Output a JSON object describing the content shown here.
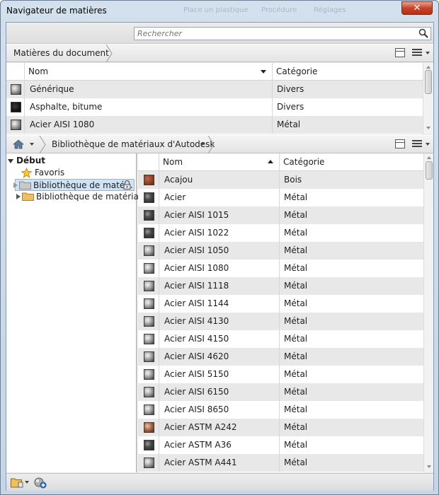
{
  "window": {
    "title": "Navigateur de matières",
    "close_glyph": "✕",
    "ghost_tabs": [
      "Place un plastique",
      "Procédure",
      "Réglages"
    ]
  },
  "search": {
    "placeholder": "Rechercher",
    "value": ""
  },
  "document_materials": {
    "breadcrumb": "Matières du document",
    "columns": [
      "Nom",
      "Catégorie"
    ],
    "rows": [
      {
        "name": "Générique",
        "category": "Divers",
        "swatch": "gray-sphere"
      },
      {
        "name": "Asphalte, bitume",
        "category": "Divers",
        "swatch": "black"
      },
      {
        "name": "Acier AISI 1080",
        "category": "Métal",
        "swatch": "gray-sphere"
      }
    ]
  },
  "library": {
    "breadcrumb": "Bibliothèque de matériaux d'Autodesk",
    "columns": [
      "Nom",
      "Catégorie"
    ],
    "rows": [
      {
        "name": "Acajou",
        "category": "Bois",
        "swatch": "wood"
      },
      {
        "name": "Acier",
        "category": "Métal",
        "swatch": "dark-sphere"
      },
      {
        "name": "Acier AISI 1015",
        "category": "Métal",
        "swatch": "dark-sphere"
      },
      {
        "name": "Acier AISI 1022",
        "category": "Métal",
        "swatch": "dark-sphere"
      },
      {
        "name": "Acier AISI 1050",
        "category": "Métal",
        "swatch": "gray-sphere"
      },
      {
        "name": "Acier AISI 1080",
        "category": "Métal",
        "swatch": "gray-sphere"
      },
      {
        "name": "Acier AISI 1118",
        "category": "Métal",
        "swatch": "gray-sphere"
      },
      {
        "name": "Acier AISI 1144",
        "category": "Métal",
        "swatch": "gray-sphere"
      },
      {
        "name": "Acier AISI 4130",
        "category": "Métal",
        "swatch": "gray-sphere"
      },
      {
        "name": "Acier AISI 4150",
        "category": "Métal",
        "swatch": "gray-sphere"
      },
      {
        "name": "Acier AISI 4620",
        "category": "Métal",
        "swatch": "gray-sphere"
      },
      {
        "name": "Acier AISI 5150",
        "category": "Métal",
        "swatch": "gray-sphere"
      },
      {
        "name": "Acier AISI 6150",
        "category": "Métal",
        "swatch": "gray-sphere"
      },
      {
        "name": "Acier AISI 8650",
        "category": "Métal",
        "swatch": "gray-sphere"
      },
      {
        "name": "Acier ASTM A242",
        "category": "Métal",
        "swatch": "copper-sphere"
      },
      {
        "name": "Acier ASTM A36",
        "category": "Métal",
        "swatch": "dark-sphere"
      },
      {
        "name": "Acier ASTM A441",
        "category": "Métal",
        "swatch": "gray-sphere"
      }
    ]
  },
  "tree": {
    "root": "Début",
    "items": [
      {
        "label": "Favoris",
        "icon": "star-icon"
      },
      {
        "label": "Bibliothèque de maté...",
        "icon": "folder-icon",
        "locked": true,
        "selected": true
      },
      {
        "label": "Bibliothèque de matériau...",
        "icon": "folder-icon",
        "locked": false,
        "selected": false
      }
    ]
  },
  "colors": {
    "window_frame": "#c6d6e8",
    "selection": "#cfe3f7",
    "row_alt": "#e8e8e8",
    "close_button": "#c7432a"
  }
}
